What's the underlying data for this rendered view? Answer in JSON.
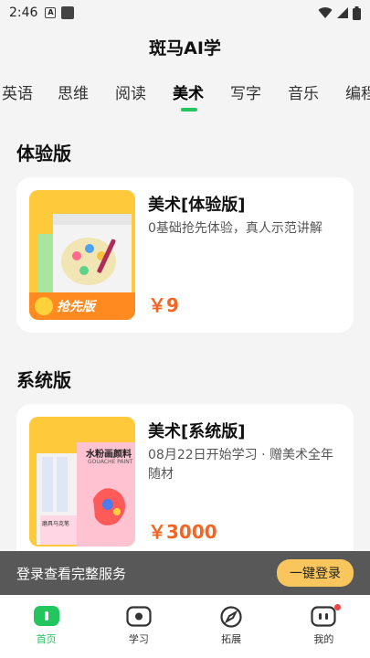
{
  "status_bar": {
    "time": "2:46",
    "a_glyph": "A"
  },
  "header": {
    "title": "斑马AI学"
  },
  "tabs": [
    {
      "label": "英语"
    },
    {
      "label": "思维"
    },
    {
      "label": "阅读"
    },
    {
      "label": "美术",
      "active": true
    },
    {
      "label": "写字"
    },
    {
      "label": "音乐"
    },
    {
      "label": "编程"
    }
  ],
  "sections": [
    {
      "title": "体验版",
      "card": {
        "title": "美术[体验版]",
        "desc": "0基础抢先体验，真人示范讲解",
        "price": "￥9",
        "badge": "抢先版"
      }
    },
    {
      "title": "系统版",
      "card": {
        "title": "美术[系统版]",
        "desc": "08月22日开始学习 · 赠美术全年随材",
        "price": "￥3000",
        "book_title": "水粉画颜料",
        "book_sub": "GOUACHE PAINT",
        "book_small": "磨具马克笔"
      }
    }
  ],
  "login_bar": {
    "text": "登录查看完整服务",
    "button": "一键登录"
  },
  "bottom_nav": [
    {
      "label": "首页",
      "icon": "home-icon",
      "active": true
    },
    {
      "label": "学习",
      "icon": "study-icon"
    },
    {
      "label": "拓展",
      "icon": "explore-icon"
    },
    {
      "label": "我的",
      "icon": "profile-icon"
    }
  ],
  "colors": {
    "accent": "#22c55e",
    "price": "#f26522",
    "login_button": "#f8c65c"
  }
}
